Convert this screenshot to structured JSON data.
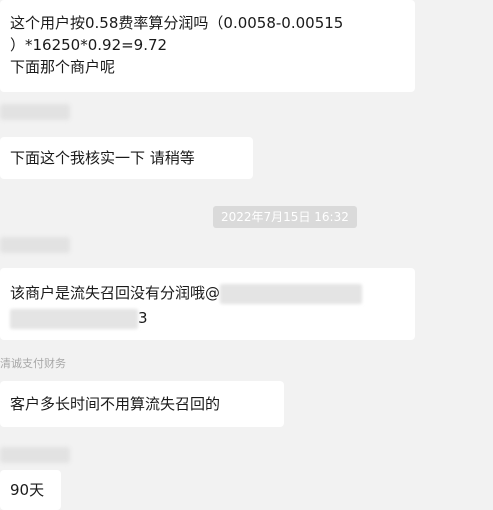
{
  "messages": [
    {
      "line1": "这个用户按0.58费率算分润吗（0.0058-0.00515",
      "line2": "）*16250*0.92=9.72",
      "line3": "下面那个商户呢"
    },
    {
      "text": "下面这个我核实一下 请稍等"
    },
    {
      "timestamp": "2022年7月15日 16:32"
    },
    {
      "line1": "该商户是流失召回没有分润哦@",
      "line2": "3"
    },
    {
      "sender": "清诚支付财务"
    },
    {
      "text": "客户多长时间不用算流失召回的"
    },
    {
      "text": "90天"
    }
  ]
}
